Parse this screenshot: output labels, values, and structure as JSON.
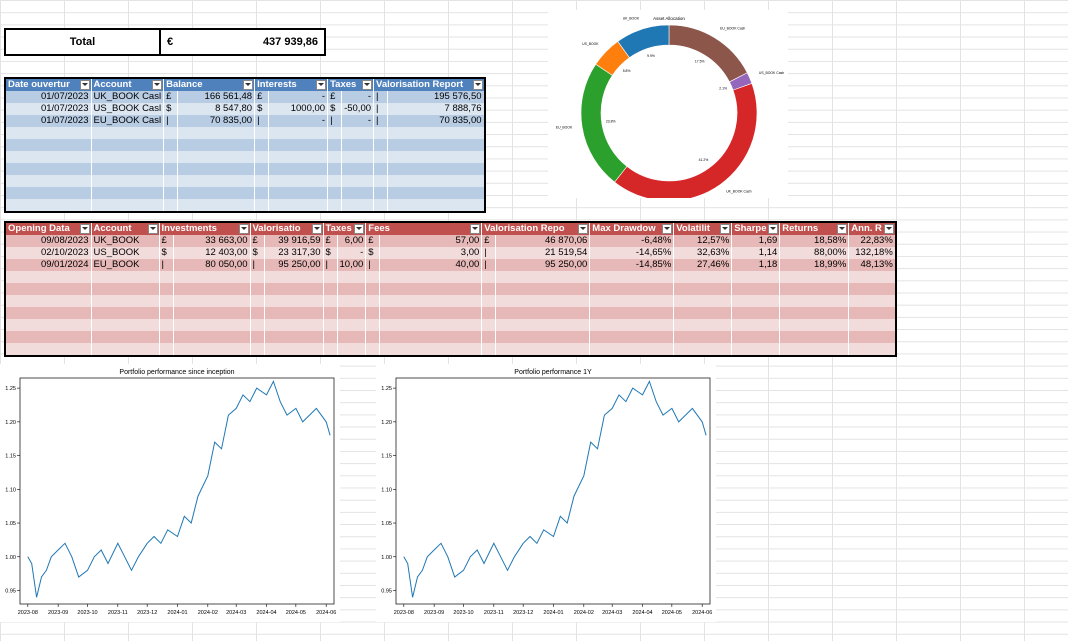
{
  "total": {
    "label": "Total",
    "currency": "€",
    "value": "437 939,86"
  },
  "accounts_table": {
    "headers": [
      "Date ouvertur",
      "Account",
      "Balance",
      "Interests",
      "Taxes",
      "Valorisation Report"
    ],
    "rows": [
      [
        "01/07/2023",
        "UK_BOOK Casl",
        "£",
        "166 561,48",
        "£",
        "-",
        "£",
        "-",
        "|",
        "195 576,50"
      ],
      [
        "01/07/2023",
        "US_BOOK Casl",
        "$",
        "8 547,80",
        "$",
        "1000,00",
        "$",
        "-50,00",
        "|",
        "7 888,76"
      ],
      [
        "01/07/2023",
        "EU_BOOK Casl",
        "|",
        "70 835,00",
        "|",
        "-",
        "|",
        "-",
        "|",
        "70 835,00"
      ]
    ]
  },
  "investments_table": {
    "headers": [
      "Opening Data",
      "Account",
      "Investments",
      "Valorisatio",
      "Taxes",
      "Fees",
      "Valorisation Repo",
      "Max Drawdow",
      "Volatilit",
      "Sharpe",
      "Returns",
      "Ann. R"
    ],
    "rows": [
      [
        "09/08/2023",
        "UK_BOOK",
        "£",
        "33 663,00",
        "£",
        "39 916,59",
        "£",
        "6,00",
        "£",
        "57,00",
        "£",
        "46 870,06",
        "-6,48%",
        "12,57%",
        "1,69",
        "18,58%",
        "22,83%"
      ],
      [
        "02/10/2023",
        "US_BOOK",
        "$",
        "12 403,00",
        "$",
        "23 317,30",
        "$",
        "-",
        "$",
        "3,00",
        "|",
        "21 519,54",
        "-14,65%",
        "32,63%",
        "1,14",
        "88,00%",
        "132,18%"
      ],
      [
        "09/01/2024",
        "EU_BOOK",
        "|",
        "80 050,00",
        "|",
        "95 250,00",
        "|",
        "10,00",
        "|",
        "40,00",
        "|",
        "95 250,00",
        "-14,85%",
        "27,46%",
        "1,18",
        "18,99%",
        "48,13%"
      ]
    ]
  },
  "chart_data": [
    {
      "type": "pie",
      "title": "Asset Allocation",
      "categories": [
        "UK_BOOK Cash",
        "US_BOOK Cash",
        "UK_BOOK Cash",
        "EU_BOOK",
        "US_BOOK",
        "UK_BOOK"
      ],
      "label_texts": [
        "EU_BOOK Cash",
        "US_BOOK Cash",
        "UK_BOOK Cash",
        "EU_BOOK",
        "US_BOOK",
        "UK_BOOK"
      ],
      "values": [
        17.5,
        2.1,
        41.2,
        23.8,
        5.8,
        9.9
      ],
      "pct_labels": [
        "17.5%",
        "2.1%",
        "41.2%",
        "23.8%",
        "5.8%",
        "9.9%"
      ],
      "colors": [
        "#8c564b",
        "#9467bd",
        "#d62728",
        "#2ca02c",
        "#ff7f0e",
        "#1f77b4"
      ]
    },
    {
      "type": "line",
      "title": "Portfolio performance since inception",
      "x_ticks": [
        "2023-08",
        "2023-09",
        "2023-10",
        "2023-11",
        "2023-12",
        "2024-01",
        "2024-02",
        "2024-03",
        "2024-04",
        "2024-05",
        "2024-06"
      ],
      "y_ticks": [
        "0.95",
        "1.00",
        "1.05",
        "1.10",
        "1.15",
        "1.20",
        "1.25"
      ],
      "ylim": [
        0.93,
        1.265
      ],
      "x_range": [
        "2023-07-24",
        "2024-06-09"
      ],
      "series": [
        {
          "x": [
            "2023-08-01",
            "2023-08-05",
            "2023-08-10",
            "2023-08-15",
            "2023-08-20",
            "2023-08-25",
            "2023-09-01",
            "2023-09-08",
            "2023-09-15",
            "2023-09-22",
            "2023-10-01",
            "2023-10-08",
            "2023-10-15",
            "2023-10-22",
            "2023-11-01",
            "2023-11-08",
            "2023-11-15",
            "2023-11-22",
            "2023-12-01",
            "2023-12-08",
            "2023-12-15",
            "2023-12-22",
            "2024-01-01",
            "2024-01-08",
            "2024-01-15",
            "2024-01-22",
            "2024-02-01",
            "2024-02-08",
            "2024-02-15",
            "2024-02-22",
            "2024-03-01",
            "2024-03-08",
            "2024-03-15",
            "2024-03-22",
            "2024-04-01",
            "2024-04-08",
            "2024-04-15",
            "2024-04-22",
            "2024-05-01",
            "2024-05-08",
            "2024-05-15",
            "2024-05-22",
            "2024-06-01",
            "2024-06-05"
          ],
          "values": [
            1.0,
            0.99,
            0.94,
            0.97,
            0.98,
            1.0,
            1.01,
            1.02,
            1.0,
            0.97,
            0.98,
            1.0,
            1.01,
            0.99,
            1.02,
            1.0,
            0.98,
            1.0,
            1.02,
            1.03,
            1.02,
            1.04,
            1.03,
            1.06,
            1.05,
            1.09,
            1.12,
            1.17,
            1.16,
            1.21,
            1.22,
            1.24,
            1.23,
            1.25,
            1.24,
            1.26,
            1.23,
            1.21,
            1.22,
            1.2,
            1.21,
            1.22,
            1.2,
            1.18
          ],
          "color": "#1f77b4"
        }
      ]
    },
    {
      "type": "line",
      "title": "Portfolio performance 1Y",
      "x_ticks": [
        "2023-08",
        "2023-09",
        "2023-10",
        "2023-11",
        "2023-12",
        "2024-01",
        "2024-02",
        "2024-03",
        "2024-04",
        "2024-05",
        "2024-06"
      ],
      "y_ticks": [
        "0.95",
        "1.00",
        "1.05",
        "1.10",
        "1.15",
        "1.20",
        "1.25"
      ],
      "ylim": [
        0.93,
        1.265
      ],
      "x_range": [
        "2023-07-24",
        "2024-06-09"
      ],
      "series": [
        {
          "x": [
            "2023-08-01",
            "2023-08-05",
            "2023-08-10",
            "2023-08-15",
            "2023-08-20",
            "2023-08-25",
            "2023-09-01",
            "2023-09-08",
            "2023-09-15",
            "2023-09-22",
            "2023-10-01",
            "2023-10-08",
            "2023-10-15",
            "2023-10-22",
            "2023-11-01",
            "2023-11-08",
            "2023-11-15",
            "2023-11-22",
            "2023-12-01",
            "2023-12-08",
            "2023-12-15",
            "2023-12-22",
            "2024-01-01",
            "2024-01-08",
            "2024-01-15",
            "2024-01-22",
            "2024-02-01",
            "2024-02-08",
            "2024-02-15",
            "2024-02-22",
            "2024-03-01",
            "2024-03-08",
            "2024-03-15",
            "2024-03-22",
            "2024-04-01",
            "2024-04-08",
            "2024-04-15",
            "2024-04-22",
            "2024-05-01",
            "2024-05-08",
            "2024-05-15",
            "2024-05-22",
            "2024-06-01",
            "2024-06-05"
          ],
          "values": [
            1.0,
            0.99,
            0.94,
            0.97,
            0.98,
            1.0,
            1.01,
            1.02,
            1.0,
            0.97,
            0.98,
            1.0,
            1.01,
            0.99,
            1.02,
            1.0,
            0.98,
            1.0,
            1.02,
            1.03,
            1.02,
            1.04,
            1.03,
            1.06,
            1.05,
            1.09,
            1.12,
            1.17,
            1.16,
            1.21,
            1.22,
            1.24,
            1.23,
            1.25,
            1.24,
            1.26,
            1.23,
            1.21,
            1.22,
            1.2,
            1.21,
            1.22,
            1.2,
            1.18
          ],
          "color": "#1f77b4"
        }
      ]
    }
  ]
}
